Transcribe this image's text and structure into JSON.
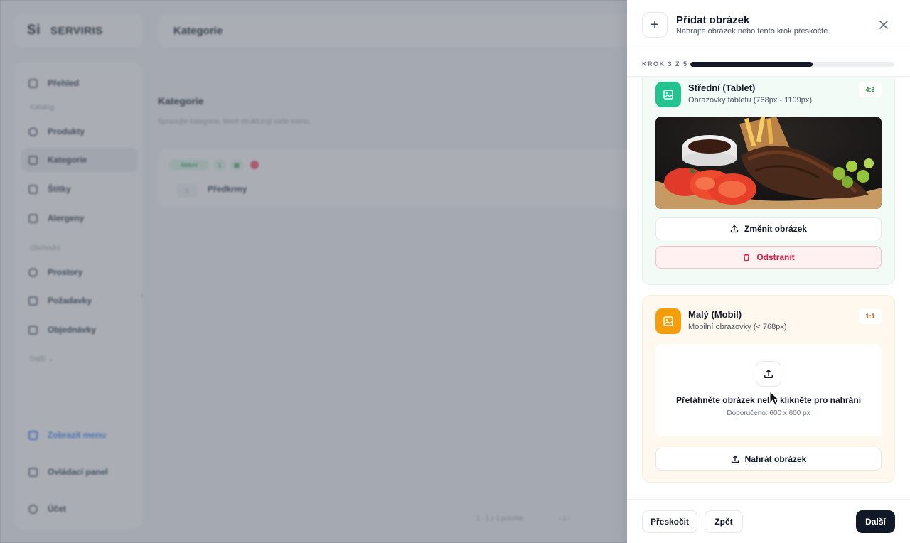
{
  "background": {
    "logo_mark": "Si",
    "logo_text": "SERVIRIS",
    "page_title": "Kategorie",
    "nav": {
      "overview": "Přehled",
      "section_catalog": "Katalog",
      "products": "Produkty",
      "categories": "Kategorie",
      "tags": "Štítky",
      "allergens": "Alergeny",
      "section_business": "Obchodní",
      "spaces": "Prostory",
      "requests": "Požadavky",
      "orders": "Objednávky",
      "more": "Další ⌄",
      "show_menu": "Zobrazit menu",
      "control_panel": "Ovládací panel",
      "account": "Účet"
    },
    "content": {
      "title": "Kategorie",
      "subtitle": "Spravujte kategorie, které strukturují vaše menu.",
      "pill_active": "Aktivní",
      "pill_count": "1",
      "row_number": "1",
      "row_name": "Předkrmy",
      "pager_left": "1 - 1 z 1 položek",
      "pager_right": "‹ 1 ›"
    }
  },
  "drawer": {
    "title": "Přidat obrázek",
    "subtitle": "Nahrajte obrázek nebo tento krok přeskočte.",
    "step_label": "KROK 3 Z 5",
    "progress": 0.6,
    "cards": {
      "tablet": {
        "title": "Střední (Tablet)",
        "subtitle": "Obrazovky tabletu (768px - 1199px)",
        "ratio": "4:3",
        "change_button": "Změnit obrázek",
        "remove_button": "Odstranit",
        "accent": "#22c38e"
      },
      "mobile": {
        "title": "Malý (Mobil)",
        "subtitle": "Mobilní obrazovky (< 768px)",
        "ratio": "1:1",
        "drop_text": "Přetáhněte obrázek nebo klikněte pro nahrání",
        "drop_hint": "Doporučeno: 600 x 600 px",
        "upload_button": "Nahrát obrázek",
        "accent": "#f59e0b"
      }
    },
    "footer": {
      "skip": "Přeskočit",
      "back": "Zpět",
      "next": "Další"
    }
  }
}
